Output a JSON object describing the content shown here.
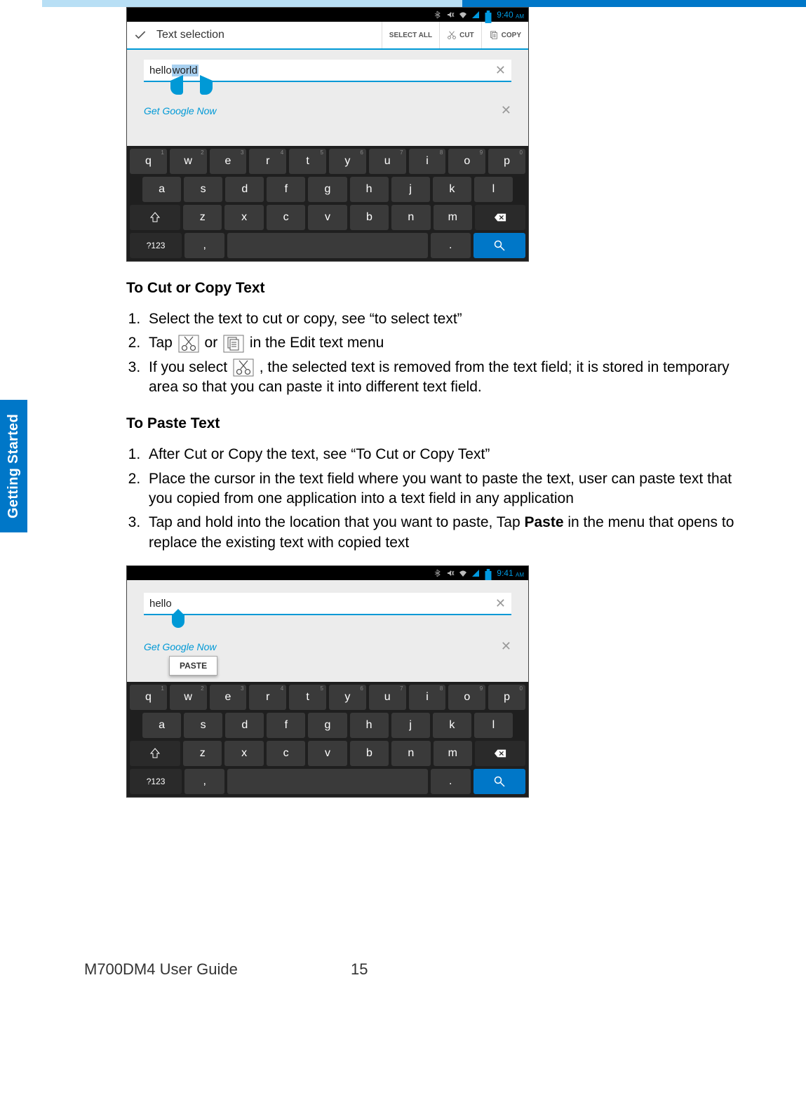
{
  "sideTab": "Getting Started",
  "shot1": {
    "time": "9:40",
    "time_ampm": "AM",
    "actionbar": {
      "title": "Text selection",
      "selectAll": "SELECT ALL",
      "cut": "CUT",
      "copy": "COPY"
    },
    "input": {
      "typed": "hello ",
      "selected": "world"
    },
    "suggestion": "Get Google Now"
  },
  "section1": {
    "heading": "To Cut or Copy Text",
    "li1": "Select the text to cut or copy, see “to select text”",
    "li2a": "Tap ",
    "li2b": "or ",
    "li2c": "in the Edit text menu",
    "li3a": "If you select ",
    "li3b": ", the selected text is removed from the text field; it is stored in temporary area so that you can paste it into different text field."
  },
  "section2": {
    "heading": "To Paste Text",
    "li1": "After Cut or Copy the text, see “To Cut or Copy Text”",
    "li2": "Place the cursor in the text field where you want to paste the text, user can paste text that you copied from one application into a text field in any application",
    "li3a": "Tap and hold into the location that you want to paste, Tap ",
    "li3b": "Paste",
    "li3c": " in the menu that opens to replace the existing text with copied text"
  },
  "shot2": {
    "time": "9:41",
    "time_ampm": "AM",
    "input": {
      "typed": "hello"
    },
    "suggestion": "Get Google Now",
    "paste": "PASTE"
  },
  "keyboard": {
    "row1": [
      {
        "l": "q",
        "h": "1"
      },
      {
        "l": "w",
        "h": "2"
      },
      {
        "l": "e",
        "h": "3"
      },
      {
        "l": "r",
        "h": "4"
      },
      {
        "l": "t",
        "h": "5"
      },
      {
        "l": "y",
        "h": "6"
      },
      {
        "l": "u",
        "h": "7"
      },
      {
        "l": "i",
        "h": "8"
      },
      {
        "l": "o",
        "h": "9"
      },
      {
        "l": "p",
        "h": "0"
      }
    ],
    "row2": [
      "a",
      "s",
      "d",
      "f",
      "g",
      "h",
      "j",
      "k",
      "l"
    ],
    "row3": [
      "z",
      "x",
      "c",
      "v",
      "b",
      "n",
      "m"
    ],
    "symKey": "?123",
    "comma": ",",
    "period": "."
  },
  "footer": {
    "left": "M700DM4 User Guide",
    "page": "15"
  }
}
